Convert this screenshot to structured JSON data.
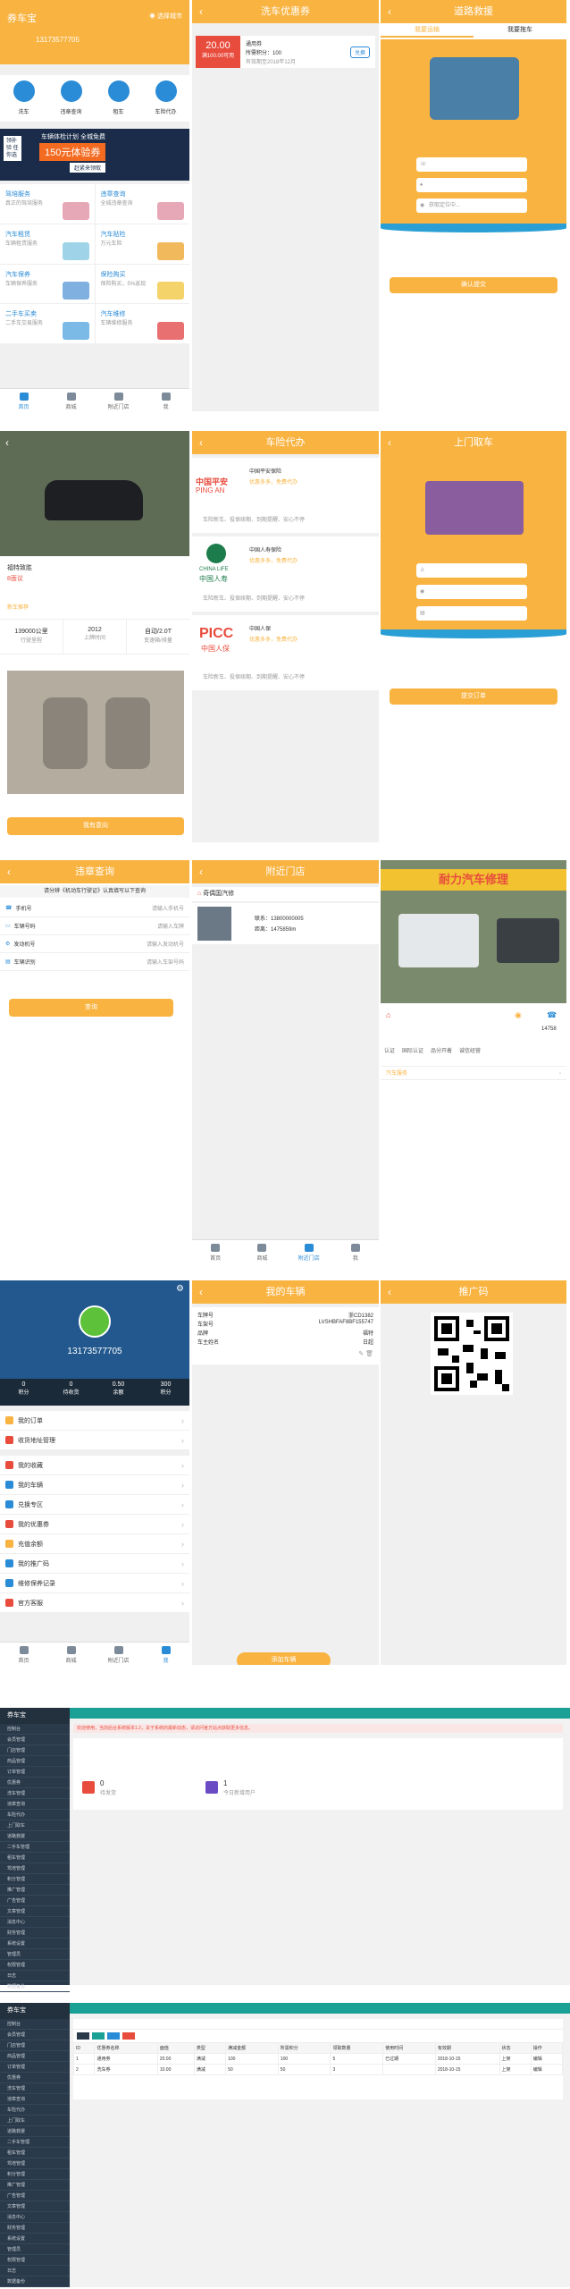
{
  "home": {
    "logo": "券车宝",
    "city": "选择城市",
    "phone": "13173577705",
    "icons": [
      "洗车",
      "违章查询",
      "租车",
      "车险代办"
    ],
    "banner_line1": "领补验 任你选",
    "banner_line2": "车辆体检计划 全城免费",
    "banner_big": "150元体验券",
    "banner_btn": "赶紧来领取",
    "cards": [
      {
        "title": "驾培服务",
        "sub": "真正的驾培服务"
      },
      {
        "title": "违章查询",
        "sub": "全城违章查询"
      },
      {
        "title": "汽车租赁",
        "sub": "车辆租赁服务"
      },
      {
        "title": "汽车贴险",
        "sub": "万元车险"
      },
      {
        "title": "汽车保养",
        "sub": "车辆保养服务"
      },
      {
        "title": "保险购买",
        "sub": "保险购买，5%返现"
      },
      {
        "title": "二手车买卖",
        "sub": "二手车交易服务"
      },
      {
        "title": "汽车维修",
        "sub": "车辆维修服务"
      }
    ],
    "tabs": [
      "首页",
      "商城",
      "附近门店",
      "我"
    ]
  },
  "coupon": {
    "title": "洗车优惠券",
    "amount": "20.00",
    "amount_note": "满100.00可用",
    "name": "通用券",
    "points": "所需积分：100",
    "expire": "有效期至2018年12月",
    "exchange": "兑换"
  },
  "rescue": {
    "title": "道路救援",
    "tabs": [
      "我要运输",
      "我要拖车"
    ],
    "fields": [
      "",
      "",
      ""
    ],
    "location": "获取定位中...",
    "submit": "确认提交"
  },
  "car_detail": {
    "car_name": "福特致胜",
    "price": "8面议",
    "tag": "新车推荐",
    "stats": [
      {
        "v": "139000公里",
        "l": "行驶里程"
      },
      {
        "v": "2012",
        "l": "上牌时间"
      },
      {
        "v": "自动/2.0T",
        "l": "变速箱/排量"
      }
    ],
    "call": "我有意向"
  },
  "insurance": {
    "title": "车险代办",
    "items": [
      {
        "logo": "中国平安",
        "logo_en": "PING AN",
        "name": "中国平安保险",
        "note": "优惠多多，免费代办",
        "desc": "车险新车、投保续期、到期提醒、安心不停"
      },
      {
        "logo": "中国人寿",
        "logo_en": "CHINA LIFE",
        "name": "中国人寿保险",
        "note": "优惠多多，免费代办",
        "desc": "车险新车、投保续期、到期提醒、安心不停"
      },
      {
        "logo": "PICC",
        "logo_en": "中国人保",
        "name": "中国人保",
        "note": "优惠多多，免费代办",
        "desc": "车险新车、投保续期、到期提醒、安心不停"
      }
    ]
  },
  "pickup": {
    "title": "上门取车",
    "submit": "提交订单"
  },
  "violation": {
    "title": "违章查询",
    "tip": "请分辨《机动车行驶证》认真填写以下查询",
    "rows": [
      {
        "label": "手机号",
        "ph": "请输入手机号"
      },
      {
        "label": "车辆号码",
        "ph": "请输入车牌"
      },
      {
        "label": "发动机号",
        "ph": "请输入发动机号"
      },
      {
        "label": "车辆识别",
        "ph": "请输入车架号码"
      }
    ],
    "submit": "查询"
  },
  "nearby": {
    "title": "附近门店",
    "shop": "奇偶国汽修",
    "contact": "联系：13800000005",
    "distance": "距离：1475859m"
  },
  "shop": {
    "sign": "耐力汽车修理",
    "tel": "14758",
    "tags": [
      "认证",
      "国际认证",
      "品分开着",
      "诚信经营"
    ],
    "service": "汽车服务"
  },
  "profile": {
    "phone": "13173577705",
    "stats": [
      {
        "v": "0",
        "l": "积分"
      },
      {
        "v": "0",
        "l": "待收货"
      },
      {
        "v": "0.50",
        "l": "余额"
      },
      {
        "v": "300",
        "l": "积分"
      }
    ],
    "menu": [
      "我的订单",
      "收货地址管理",
      "我的收藏",
      "我的车辆",
      "兑换专区",
      "我的优惠券",
      "充值余额",
      "我的推广码",
      "维修保养记录",
      "官方客服"
    ]
  },
  "mycar": {
    "title": "我的车辆",
    "fields": [
      [
        "车牌号",
        "浙CD1382"
      ],
      [
        "车架号",
        "LVSHBFAF8BF155747"
      ],
      [
        "品牌",
        "福特"
      ],
      [
        "车主姓名",
        "日超"
      ]
    ],
    "add": "添加车辆"
  },
  "qr": {
    "title": "推广码"
  },
  "admin1": {
    "logo": "券车宝",
    "alert": "欢迎使用，当前后台系统版本1.2，关于系统的最新动态，请访问官方站点获取更多信息。",
    "stat1": {
      "v": "0",
      "l": "待发货"
    },
    "stat2": {
      "v": "1",
      "l": "今日新增用户"
    },
    "side": [
      "控制台",
      "会员管理",
      "门店管理",
      "商品管理",
      "订单管理",
      "优惠券",
      "洗车管理",
      "违章查询",
      "车险代办",
      "上门取车",
      "道路救援",
      "二手车管理",
      "租车管理",
      "驾培管理",
      "积分管理",
      "推广管理",
      "广告管理",
      "文章管理",
      "消息中心",
      "财务管理",
      "系统设置",
      "管理员",
      "权限管理",
      "日志",
      "数据备份"
    ]
  },
  "admin2": {
    "logo": "券车宝",
    "headers": [
      "ID",
      "优惠券名称",
      "面值",
      "类型",
      "满减金额",
      "所需积分",
      "领取数量",
      "使用时间",
      "有效期",
      "状态",
      "操作"
    ],
    "rows": [
      [
        "1",
        "通用券",
        "20.00",
        "满减",
        "100",
        "100",
        "5",
        "已过期",
        "2018-10-15",
        "上架",
        "编辑"
      ],
      [
        "2",
        "洗车券",
        "10.00",
        "满减",
        "50",
        "50",
        "3",
        "",
        "2018-10-15",
        "上架",
        "编辑"
      ]
    ]
  },
  "colors": {
    "accent": "#f9b340",
    "admin_green": "#1aa094",
    "dark": "#2b3a4a"
  }
}
